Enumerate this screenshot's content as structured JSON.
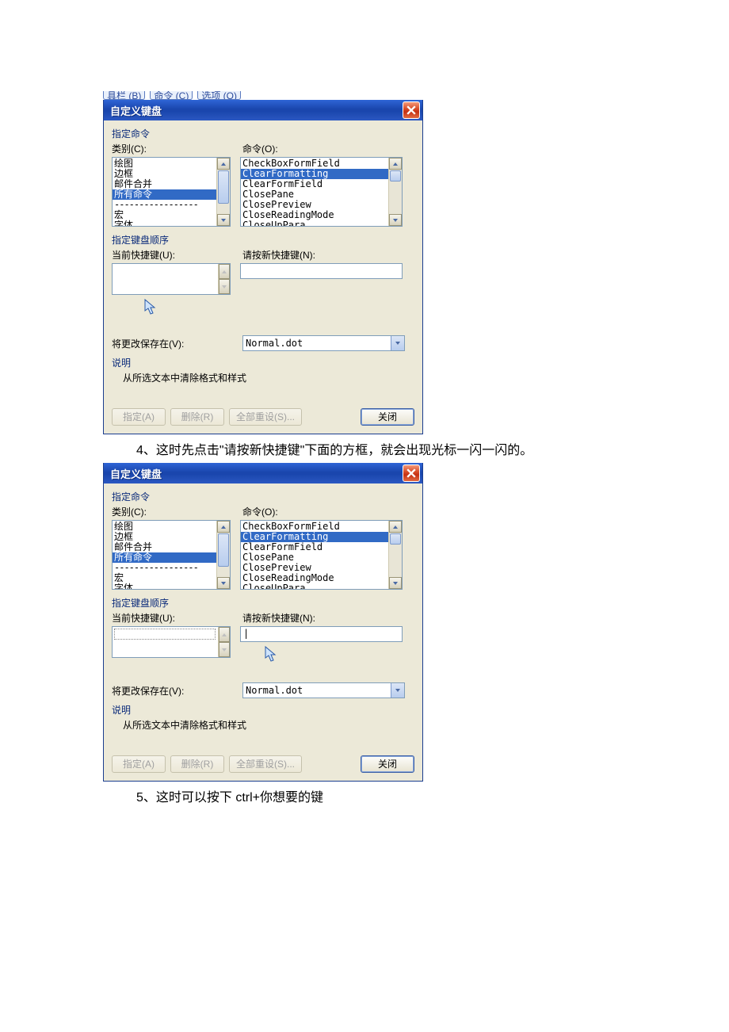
{
  "tabs": {
    "t1": "具栏 (B)",
    "t2": "命令 (C)",
    "t3": "选项 (O)"
  },
  "dialog": {
    "title": "自定义键盘",
    "group_cmd": "指定命令",
    "label_category": "类别(C):",
    "label_command": "命令(O):",
    "categories": [
      "绘图",
      "边框",
      "邮件合并",
      "所有命令",
      "宏",
      "字体"
    ],
    "sep": "-----------------",
    "commands": [
      "CheckBoxFormField",
      "ClearFormatting",
      "ClearFormField",
      "ClosePane",
      "ClosePreview",
      "CloseReadingMode",
      "CloseUpPara"
    ],
    "selected_cmd_index": 1,
    "group_keys": "指定键盘顺序",
    "label_current": "当前快捷键(U):",
    "label_new": "请按新快捷键(N):",
    "label_savein": "将更改保存在(V):",
    "savein_value": "Normal.dot",
    "group_desc": "说明",
    "desc_text": "从所选文本中清除格式和样式",
    "buttons": {
      "assign": "指定(A)",
      "remove": "删除(R)",
      "resetall": "全部重设(S)...",
      "close": "关闭"
    }
  },
  "captions": {
    "c4": "4、这时先点击\"请按新快捷键\"下面的方框，就会出现光标一闪一闪的。",
    "c5": "5、这时可以按下 ctrl+你想要的键"
  }
}
